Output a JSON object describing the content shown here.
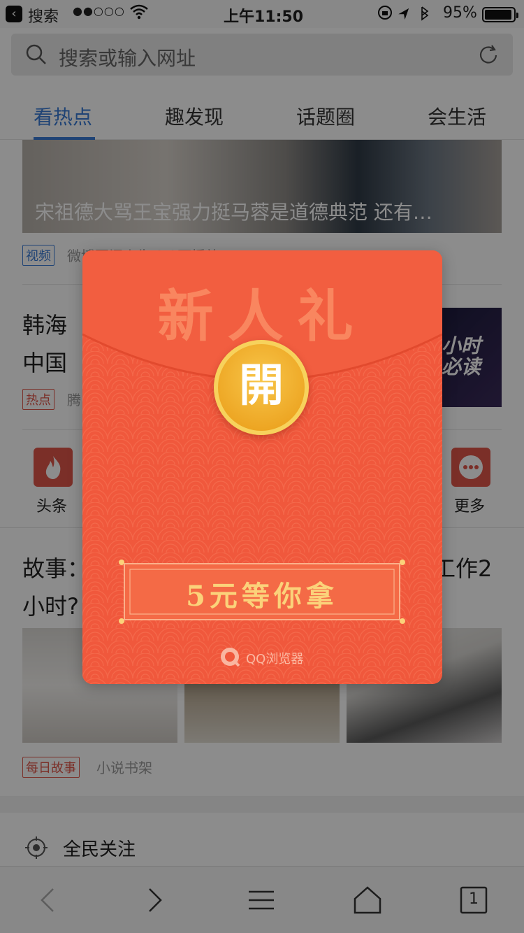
{
  "status_bar": {
    "back_app": "搜索",
    "signal": "●●○○○",
    "time": "上午11:50",
    "battery": "95%",
    "battery_level": 0.95
  },
  "search": {
    "placeholder": "搜索或输入网址"
  },
  "tabs": [
    {
      "label": "看热点",
      "active": true
    },
    {
      "label": "趣发现",
      "active": false
    },
    {
      "label": "话题圈",
      "active": false
    },
    {
      "label": "会生活",
      "active": false
    }
  ],
  "feed": {
    "item1": {
      "caption": "宋祖德大骂王宝强力挺马蓉是道德典范 还有…",
      "tag": "视频",
      "meta": "微博要闻丨生 2.2万播放"
    },
    "item2": {
      "title_line1": "韩海",
      "title_line2": "中国",
      "tag": "热点",
      "meta": "腾",
      "thumb_line1": "小时",
      "thumb_line2": "必读"
    },
    "shortcuts": [
      {
        "label": "头条",
        "icon": "flame-icon"
      },
      {
        "label": "更多",
        "icon": "more-icon"
      }
    ],
    "item3": {
      "title_line1": "故事：",
      "title_line1_right": "工作2",
      "title_line2": "小时?",
      "tag": "每日故事",
      "meta": "小说书架"
    },
    "follow": "全民关注"
  },
  "popup": {
    "title": "新人礼",
    "open_label": "開",
    "reward": "5元等你拿",
    "brand": "QQ浏览器",
    "colors": {
      "envelope": "#f0583c",
      "coin": "#f4b62f",
      "text": "#fbd27a"
    }
  },
  "toolbar": {
    "tab_count": "1"
  }
}
